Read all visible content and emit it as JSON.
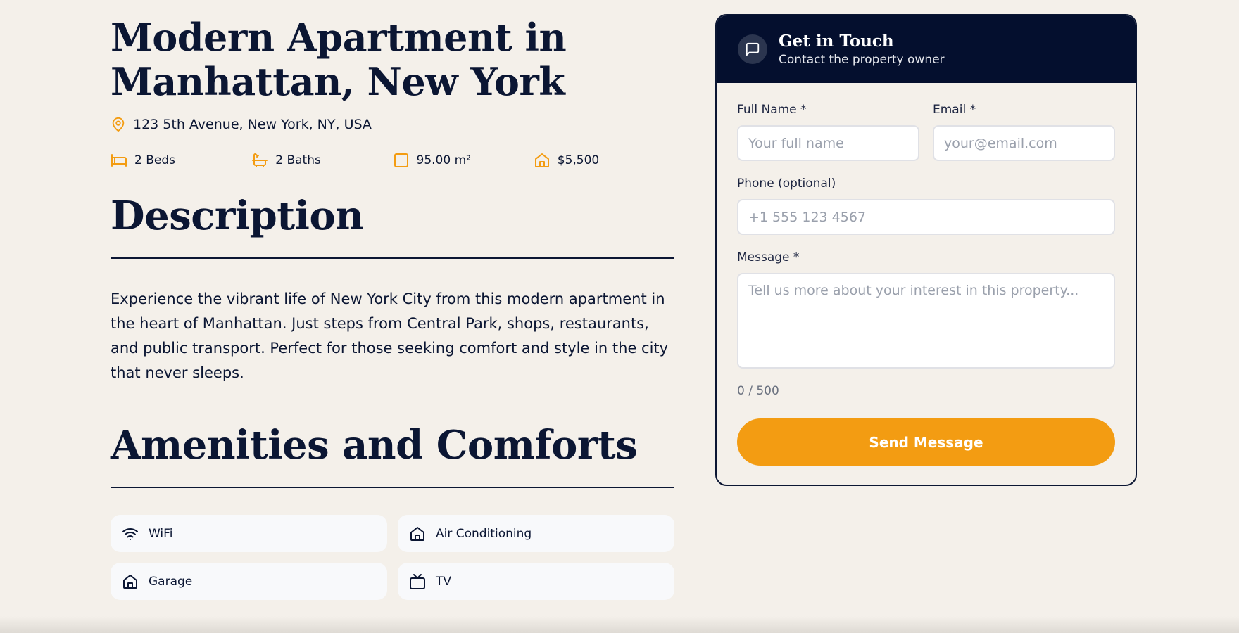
{
  "listing": {
    "title": "Modern Apartment in Manhattan, New York",
    "address": "123 5th Avenue, New York, NY, USA",
    "stats": {
      "beds": "2 Beds",
      "baths": "2 Baths",
      "area": "95.00 m²",
      "price": "$5,500"
    }
  },
  "description": {
    "heading": "Description",
    "text": "Experience the vibrant life of New York City from this modern apartment in the heart of Manhattan. Just steps from Central Park, shops, restaurants, and public transport. Perfect for those seeking comfort and style in the city that never sleeps."
  },
  "amenities": {
    "heading": "Amenities and Comforts",
    "items": [
      {
        "label": "WiFi",
        "icon": "wifi-icon"
      },
      {
        "label": "Air Conditioning",
        "icon": "home-icon"
      },
      {
        "label": "Garage",
        "icon": "home-icon"
      },
      {
        "label": "TV",
        "icon": "tv-icon"
      }
    ]
  },
  "contact": {
    "title": "Get in Touch",
    "subtitle": "Contact the property owner",
    "fields": {
      "name_label": "Full Name *",
      "name_placeholder": "Your full name",
      "email_label": "Email *",
      "email_placeholder": "your@email.com",
      "phone_label": "Phone (optional)",
      "phone_placeholder": "+1 555 123 4567",
      "message_label": "Message *",
      "message_placeholder": "Tell us more about your interest in this property..."
    },
    "counter": "0 / 500",
    "send_label": "Send Message"
  },
  "colors": {
    "accent": "#f39c12",
    "navy": "#040f2e",
    "background": "#f4f0ea"
  }
}
